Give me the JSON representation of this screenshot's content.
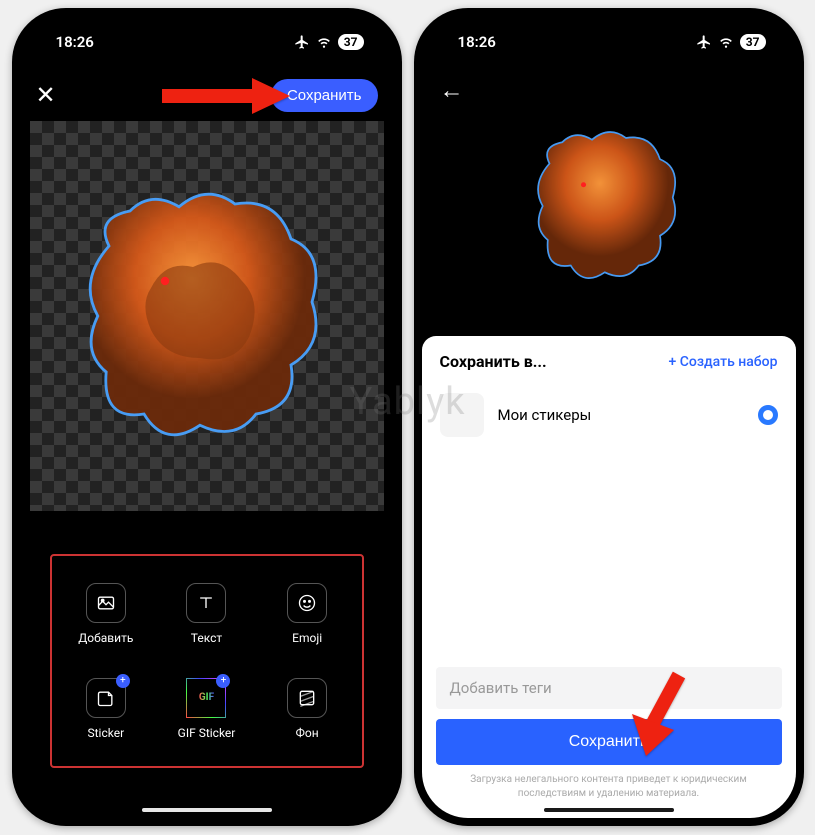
{
  "status": {
    "time": "18:26",
    "battery": "37"
  },
  "left": {
    "save_button": "Сохранить",
    "tools": {
      "add": "Добавить",
      "text": "Текст",
      "emoji": "Emoji",
      "sticker": "Sticker",
      "gif_sticker": "GIF Sticker",
      "background": "Фон",
      "gif_label": "GIF"
    }
  },
  "right": {
    "sheet_title": "Сохранить в...",
    "create_set": "+ Создать набор",
    "set_name": "Мои стикеры",
    "tags_placeholder": "Добавить теги",
    "save_button": "Сохранить",
    "disclaimer": "Загрузка нелегального контента приведет к юридическим последствиям и удалению материала."
  },
  "watermark": "Yablyk"
}
